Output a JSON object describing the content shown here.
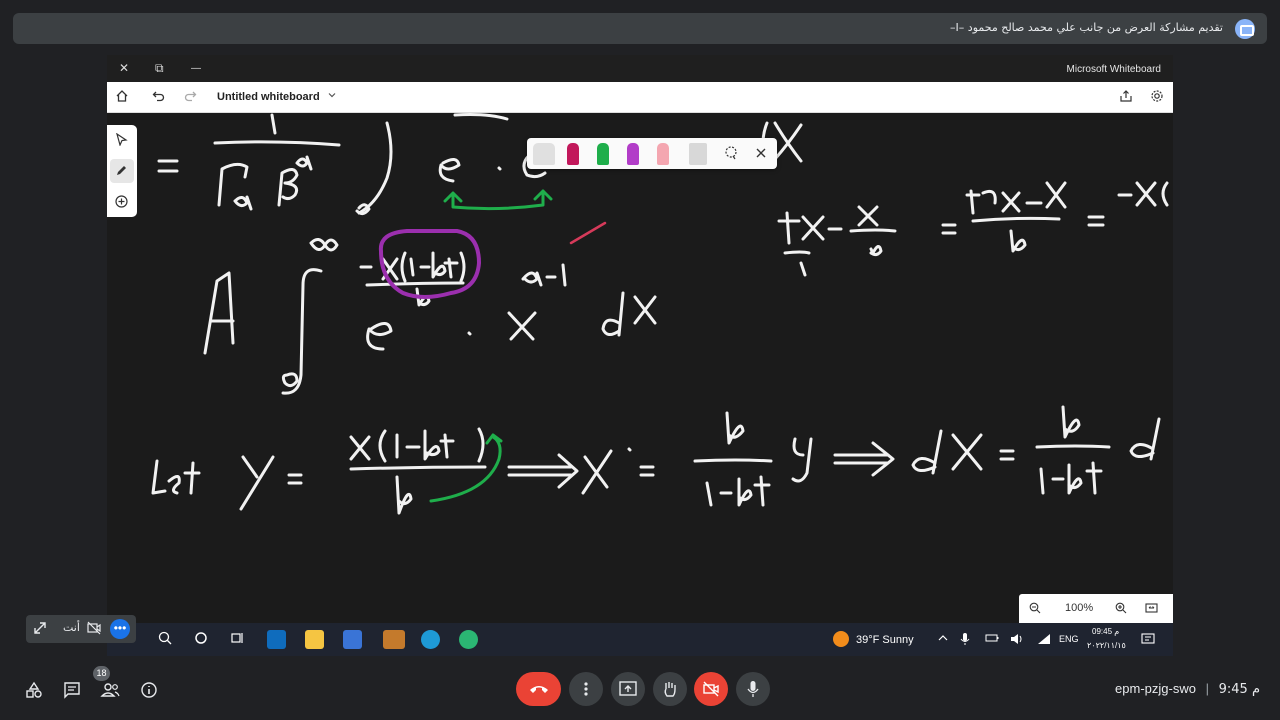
{
  "meet": {
    "banner_text": "تقديم مشاركة العرض من جانب علي محمد صالح محمود –I–",
    "self_label": "أنت",
    "participant_count": "18",
    "meeting_code": "epm-pzjg-swo",
    "separator": "|",
    "time": "9:45 م"
  },
  "window": {
    "close_glyph": "✕",
    "restore_glyph": "⧉",
    "minimize_glyph": "—",
    "app_name": "Microsoft Whiteboard"
  },
  "whiteboard": {
    "title": "Untitled whiteboard",
    "zoom": "100%"
  },
  "taskbar": {
    "weather": "39°F  Sunny",
    "language": "ENG",
    "clock_time": "09:45 م",
    "clock_date": "٢٠٢٢/١١/١٥"
  },
  "colors": {
    "accent": "#1a73e8",
    "end_call": "#ea4335",
    "ink_green": "#1fae4b",
    "ink_purple": "#9b2fae",
    "ink_red": "#d63a5a"
  }
}
